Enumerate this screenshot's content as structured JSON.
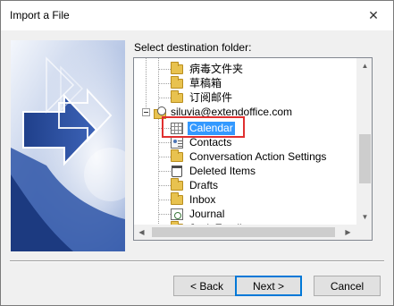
{
  "window": {
    "title": "Import a File",
    "close_glyph": "✕"
  },
  "destination_label": "Select destination folder:",
  "tree_items": [
    {
      "label": "病毒文件夹",
      "icon": "folder-icon",
      "level": 2
    },
    {
      "label": "草稿箱",
      "icon": "folder-icon",
      "level": 2
    },
    {
      "label": "订阅邮件",
      "icon": "folder-icon",
      "level": 2
    },
    {
      "label": "siluvia@extendoffice.com",
      "icon": "account-icon",
      "level": 0,
      "expanded": true
    },
    {
      "label": "Calendar",
      "icon": "calendar-icon",
      "level": 1,
      "selected": true
    },
    {
      "label": "Contacts",
      "icon": "contacts-icon",
      "level": 1
    },
    {
      "label": "Conversation Action Settings",
      "icon": "folder-icon",
      "level": 1
    },
    {
      "label": "Deleted Items",
      "icon": "trash-icon",
      "level": 1
    },
    {
      "label": "Drafts",
      "icon": "folder-icon",
      "level": 1
    },
    {
      "label": "Inbox",
      "icon": "folder-icon",
      "level": 1
    },
    {
      "label": "Journal",
      "icon": "journal-icon",
      "level": 1
    },
    {
      "label": "Junk Email",
      "icon": "folder-icon",
      "level": 1
    }
  ],
  "scrollbar": {
    "up_glyph": "▲",
    "down_glyph": "▼",
    "left_glyph": "◀",
    "right_glyph": "▶"
  },
  "buttons": {
    "back": "< Back",
    "next": "Next >",
    "cancel": "Cancel"
  },
  "colors": {
    "selection": "#3399ff",
    "highlight_box": "#e03030",
    "default_button_border": "#0078d7"
  }
}
